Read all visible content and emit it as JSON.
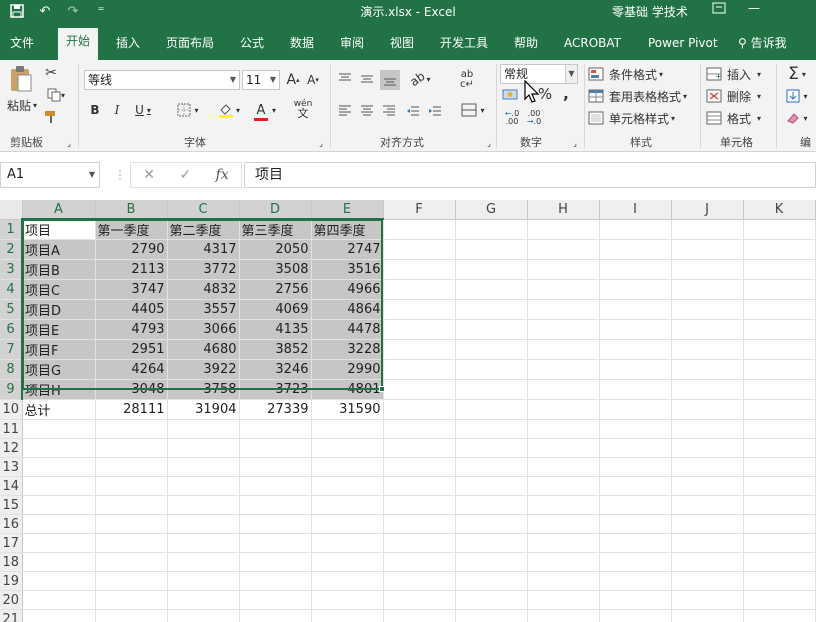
{
  "titlebar": {
    "filename": "演示.xlsx",
    "app": "Excel",
    "user": "零基础 学技术"
  },
  "tabs": [
    "文件",
    "开始",
    "插入",
    "页面布局",
    "公式",
    "数据",
    "审阅",
    "视图",
    "开发工具",
    "帮助",
    "ACROBAT",
    "Power Pivot"
  ],
  "active_tab": "开始",
  "tellme": "告诉我",
  "ribbon": {
    "clipboard": {
      "label": "剪贴板",
      "paste": "粘贴"
    },
    "font": {
      "label": "字体",
      "name": "等线",
      "size": "11",
      "bold": "B",
      "italic": "I",
      "underline": "U",
      "phonetic": "wén"
    },
    "alignment": {
      "label": "对齐方式"
    },
    "number": {
      "label": "数字",
      "format": "常规",
      "percent": "%",
      "comma": ","
    },
    "styles": {
      "label": "样式",
      "conditional": "条件格式",
      "table": "套用表格格式",
      "cell": "单元格样式"
    },
    "cells": {
      "label": "单元格",
      "insert": "插入",
      "delete": "删除",
      "format": "格式"
    },
    "editing": {
      "label": "编"
    }
  },
  "formula_bar": {
    "name_box": "A1",
    "content": "项目"
  },
  "columns": [
    "A",
    "B",
    "C",
    "D",
    "E",
    "F",
    "G",
    "H",
    "I",
    "J",
    "K"
  ],
  "rows": [
    [
      "项目",
      "第一季度",
      "第二季度",
      "第三季度",
      "第四季度"
    ],
    [
      "项目A",
      "2790",
      "4317",
      "2050",
      "2747"
    ],
    [
      "项目B",
      "2113",
      "3772",
      "3508",
      "3516"
    ],
    [
      "项目C",
      "3747",
      "4832",
      "2756",
      "4966"
    ],
    [
      "项目D",
      "4405",
      "3557",
      "4069",
      "4864"
    ],
    [
      "项目E",
      "4793",
      "3066",
      "4135",
      "4478"
    ],
    [
      "项目F",
      "2951",
      "4680",
      "3852",
      "3228"
    ],
    [
      "项目G",
      "4264",
      "3922",
      "3246",
      "2990"
    ],
    [
      "项目H",
      "3048",
      "3758",
      "3723",
      "4801"
    ],
    [
      "总计",
      "28111",
      "31904",
      "27339",
      "31590"
    ]
  ],
  "visible_row_count": 21,
  "colors": {
    "accent": "#217346",
    "selection_fill": "#c6c6c6"
  }
}
